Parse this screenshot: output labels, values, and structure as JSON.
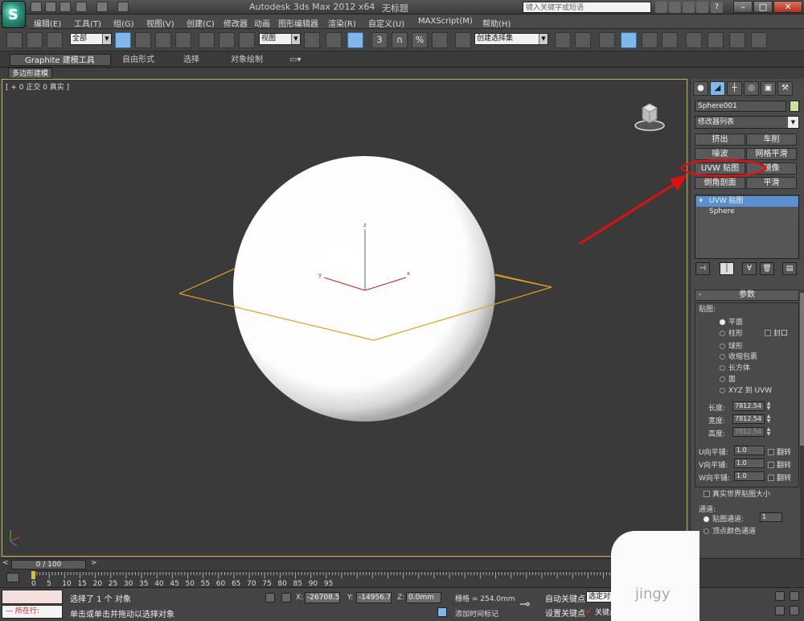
{
  "titlebar": {
    "logo": "S",
    "app_title": "Autodesk 3ds Max  2012 x64",
    "file_name": "无标题",
    "search_placeholder": "键入关键字或短语",
    "min": "–",
    "max": "□",
    "close": "✕",
    "help": "?",
    "window_min": "–",
    "window_restore": "❐",
    "window_close": "✕"
  },
  "menu": {
    "items": [
      "编辑(E)",
      "工具(T)",
      "组(G)",
      "视图(V)",
      "创建(C)",
      "修改器",
      "动画",
      "图形编辑器",
      "渲染(R)",
      "自定义(U)",
      "MAXScript(M)",
      "帮助(H)"
    ]
  },
  "toolbar": {
    "selection_filter": "全部",
    "ref_coord": "视图",
    "named_selection": "创建选择集",
    "snap_3": "3",
    "angle_snap_symbol": "∩",
    "percent_symbol": "%"
  },
  "ribbon": {
    "tabs": [
      "Graphite 建模工具",
      "自由形式",
      "选择",
      "对象绘制"
    ],
    "sub_label": "多边形建模"
  },
  "viewport": {
    "label": "[ + 0 正交 0 真实 ]",
    "axis_z": "z",
    "axis_x": "x",
    "axis_y": "y"
  },
  "command_panel": {
    "object_name": "Sphere001",
    "modifier_list": "修改器列表",
    "modifier_buttons": [
      "挤出",
      "车削",
      "噪波",
      "网格平滑",
      "UVW 贴图",
      "镜像",
      "倒角剖面",
      "平滑"
    ],
    "stack": [
      "UVW 贴图",
      "Sphere"
    ],
    "rollout_title": "参数",
    "rollout_minus": "-",
    "mapping_label": "贴图:",
    "mapping_options": [
      "平面",
      "柱形",
      "球形",
      "收缩包裹",
      "长方体",
      "面",
      "XYZ 到 UVW"
    ],
    "selected_mapping": "平面",
    "cap_label": "封口",
    "length_label": "长度:",
    "length_value": "7812.54",
    "width_label": "宽度:",
    "width_value": "7812.54",
    "height_label": "高度:",
    "height_value": "7812.54",
    "utile_label": "U向平铺:",
    "utile_value": "1.0",
    "vtile_label": "V向平铺:",
    "vtile_value": "1.0",
    "wtile_label": "W向平铺:",
    "wtile_value": "1.0",
    "flip_label": "翻转",
    "real_world_label": "真实世界贴图大小",
    "channel_label": "通道:",
    "map_channel_label": "贴图通道:",
    "map_channel_value": "1",
    "vertex_color_label": "顶点颜色通道"
  },
  "timeline": {
    "frame": "0 / 100",
    "ticks": [
      "0",
      "5",
      "10",
      "15",
      "20",
      "25",
      "30",
      "35",
      "40",
      "45",
      "50",
      "55",
      "60",
      "65",
      "70",
      "75",
      "80",
      "85",
      "90",
      "95"
    ]
  },
  "status": {
    "running": "所在行:",
    "message1": "选择了 1 个 对象",
    "message2": "单击或单击并拖动以选择对象",
    "x_label": "X:",
    "x_value": "-26708.53",
    "y_label": "Y:",
    "y_value": "-14956.79",
    "z_label": "Z:",
    "z_value": "0.0mm",
    "grid": "栅格 = 254.0mm",
    "add_time_tag": "添加时间标记",
    "auto_key": "自动关键点",
    "selected_object": "选定对象",
    "set_key": "设置关键点",
    "key_filters": "关键点过滤器...",
    "watermark": "jingy"
  },
  "colors": {
    "accent_blue": "#7fb8e8",
    "annotation_red": "#e01010",
    "grid_orange": "#e0a020"
  }
}
